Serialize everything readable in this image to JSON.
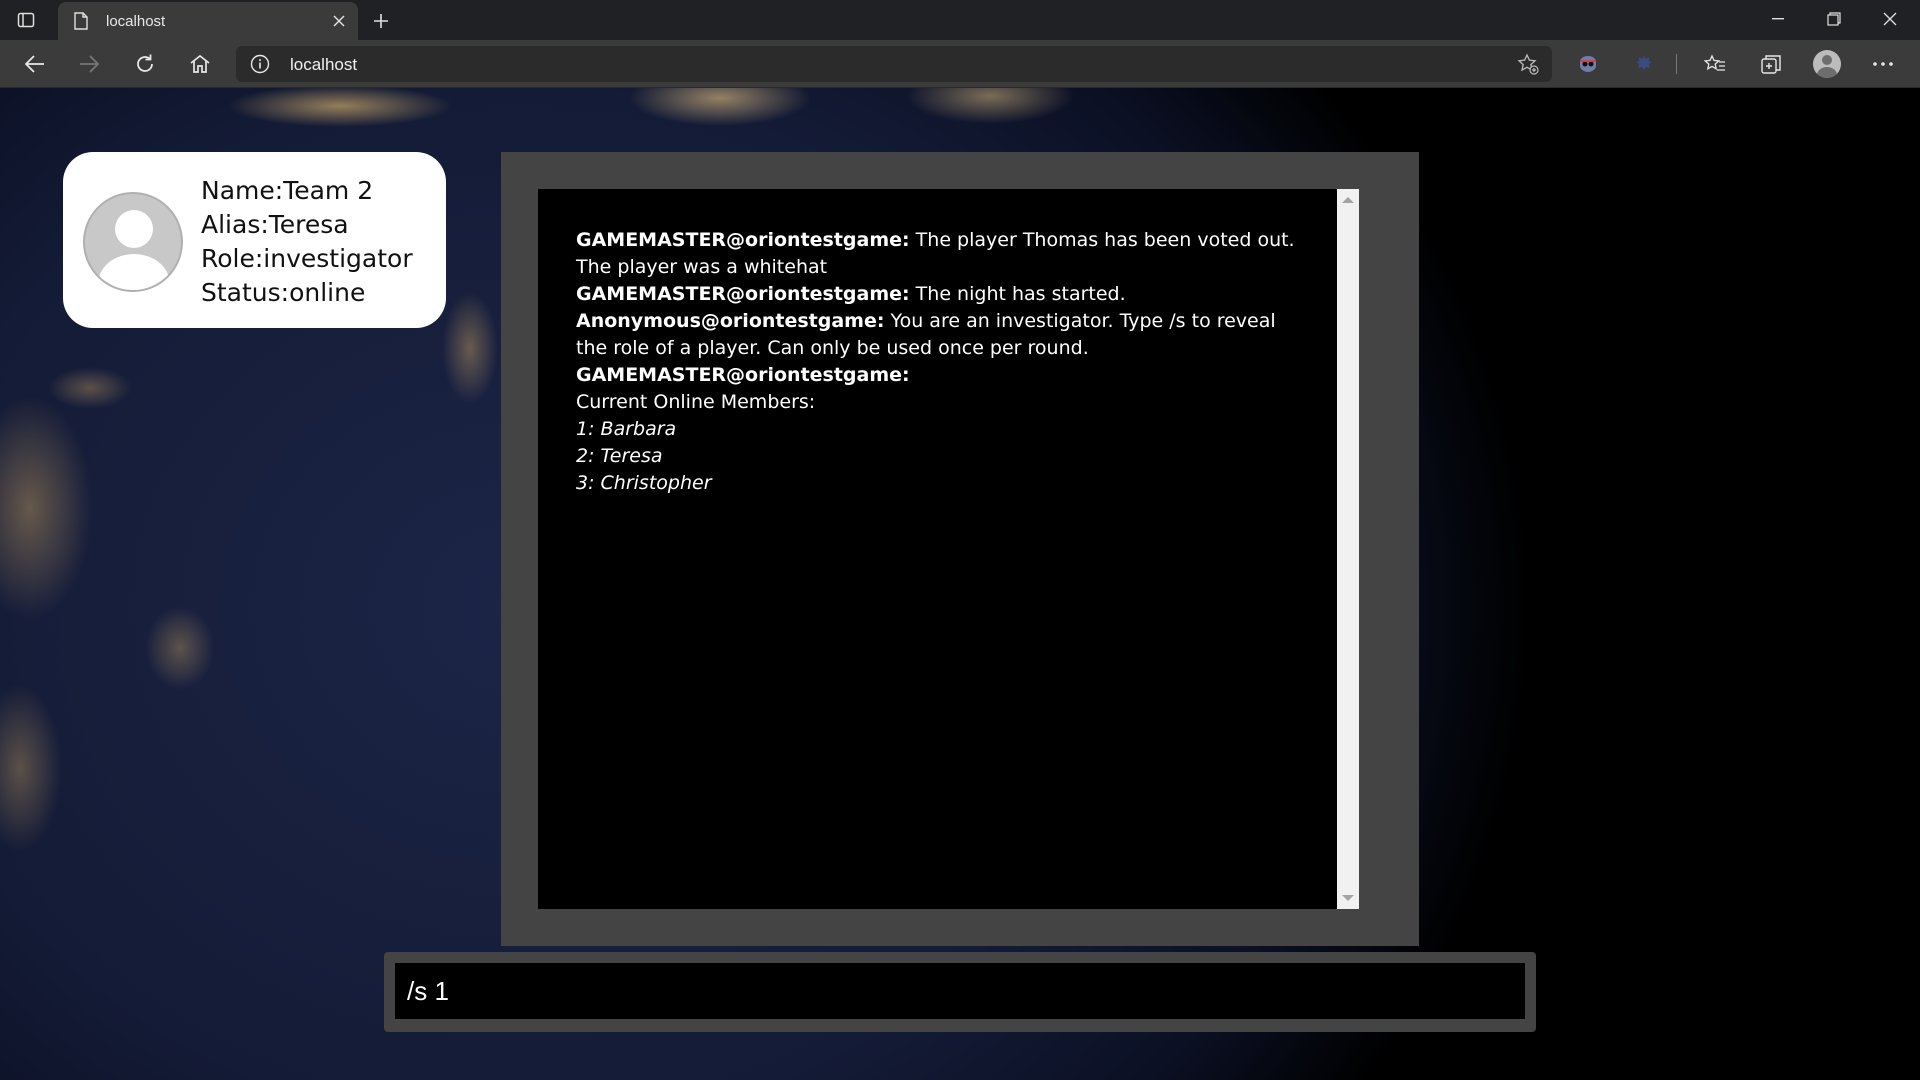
{
  "browser": {
    "tab": {
      "title": "localhost"
    },
    "address_bar": {
      "url": "localhost"
    }
  },
  "profile": {
    "name": "Name:Team 2",
    "alias": "Alias:Teresa",
    "role": "Role:investigator",
    "status": "Status:online"
  },
  "chat": {
    "messages": [
      {
        "sender": "GAMEMASTER@oriontestgame:",
        "text": " The player Thomas has been voted out. The player was a whitehat"
      },
      {
        "sender": "GAMEMASTER@oriontestgame:",
        "text": " The night has started."
      },
      {
        "sender": "Anonymous@oriontestgame:",
        "text": " You are an investigator. Type /s to reveal the role of a player. Can only be used once per round."
      },
      {
        "sender": "GAMEMASTER@oriontestgame:",
        "text": ""
      }
    ],
    "members_heading": "Current Online Members:",
    "members": [
      "1: Barbara",
      "2: Teresa",
      "3: Christopher"
    ]
  },
  "input": {
    "value": "/s 1"
  },
  "colors": {
    "chat_background": "#000000",
    "frame": "#444444",
    "card": "#ffffff"
  }
}
